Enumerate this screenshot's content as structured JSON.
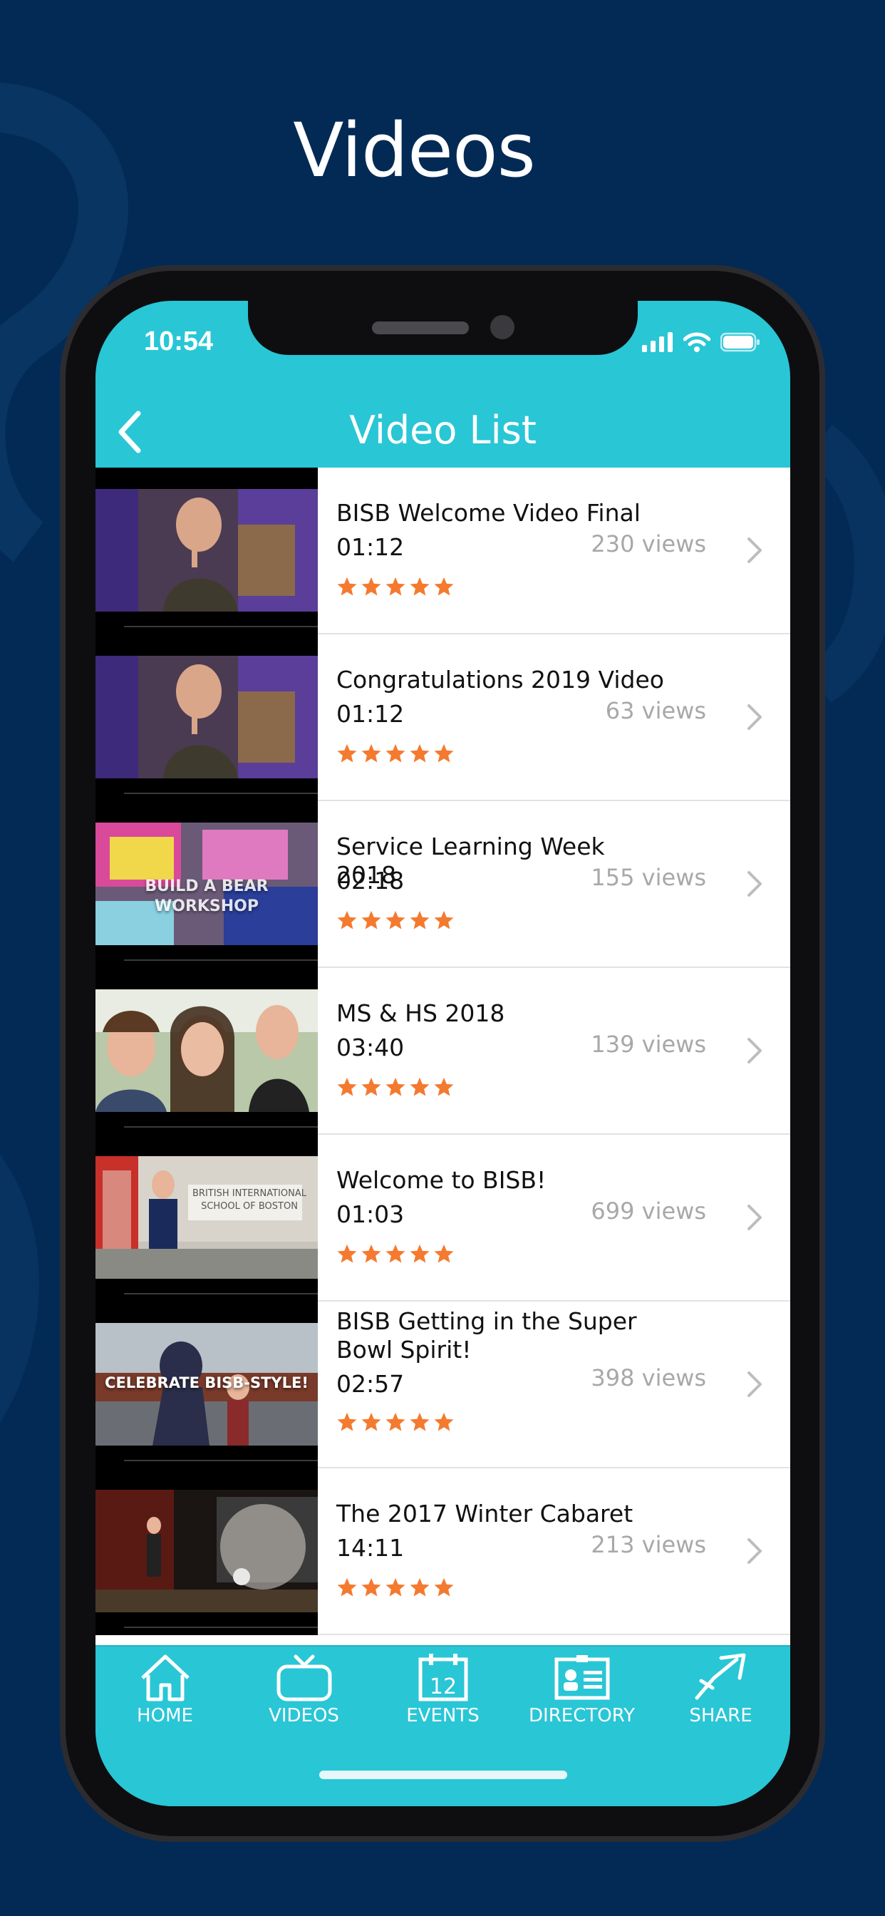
{
  "marketing_title": "Videos",
  "status_bar": {
    "time": "10:54"
  },
  "nav": {
    "title": "Video List",
    "back_icon": "chevron-left-icon"
  },
  "videos": [
    {
      "title": "BISB Welcome Video Final",
      "duration": "01:12",
      "views": "230 views",
      "rating": 5,
      "thumbnail": "man-thumbnail"
    },
    {
      "title": "Congratulations 2019 Video",
      "duration": "01:12",
      "views": "63 views",
      "rating": 5,
      "thumbnail": "man-thumbnail"
    },
    {
      "title": "Service Learning Week 2018",
      "duration": "02:18",
      "views": "155 views",
      "rating": 5,
      "thumbnail": "workshop-thumbnail",
      "thumb_caption": "BUILD A BEAR\nWORKSHOP"
    },
    {
      "title": "MS & HS 2018",
      "duration": "03:40",
      "views": "139 views",
      "rating": 5,
      "thumbnail": "students-thumbnail"
    },
    {
      "title": "Welcome to BISB!",
      "duration": "01:03",
      "views": "699 views",
      "rating": 5,
      "thumbnail": "school-thumbnail",
      "thumb_caption": "BRITISH INTERNATIONAL\nSCHOOL OF BOSTON"
    },
    {
      "title": "BISB Getting in the Super Bowl Spirit!",
      "duration": "02:57",
      "views": "398 views",
      "rating": 5,
      "thumbnail": "mascot-thumbnail",
      "thumb_caption": "CELEBRATE BISB-STYLE!"
    },
    {
      "title": "The 2017 Winter Cabaret",
      "duration": "14:11",
      "views": "213 views",
      "rating": 5,
      "thumbnail": "stage-thumbnail"
    }
  ],
  "tabs": [
    {
      "label": "HOME",
      "icon": "home-icon"
    },
    {
      "label": "VIDEOS",
      "icon": "tv-icon"
    },
    {
      "label": "EVENTS",
      "icon": "calendar-icon"
    },
    {
      "label": "DIRECTORY",
      "icon": "directory-icon"
    },
    {
      "label": "SHARE",
      "icon": "share-icon"
    }
  ],
  "events_icon_day": "12",
  "colors": {
    "background": "#032a55",
    "accent": "#29c6d6",
    "star": "#f47a2f",
    "views_text": "#a8a8a8"
  }
}
